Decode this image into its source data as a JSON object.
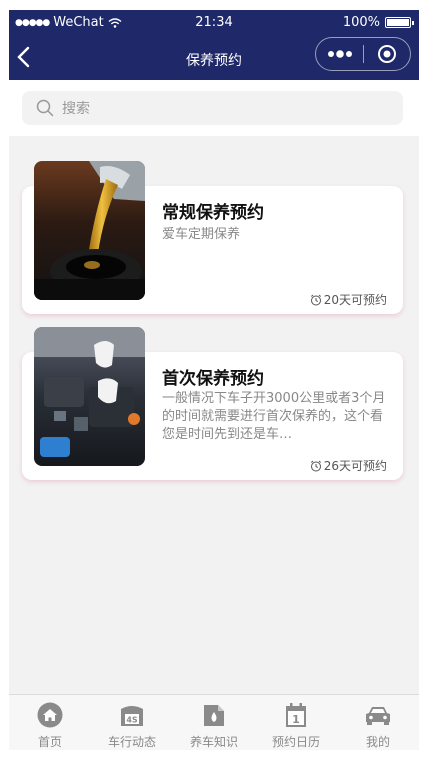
{
  "status_bar": {
    "carrier": "WeChat",
    "time": "21:34",
    "battery": "100%"
  },
  "nav": {
    "title": "保养预约"
  },
  "search": {
    "placeholder": "搜索"
  },
  "cards": [
    {
      "title": "常规保养预约",
      "subtitle": "爱车定期保养",
      "days": "20天可预约",
      "image": "oil-pouring-photo"
    },
    {
      "title": "首次保养预约",
      "subtitle": "一般情况下车子开3000公里或者3个月的时间就需要进行首次保养的，这个看您是时间先到还是车…",
      "days": "26天可预约",
      "image": "engine-repair-photo"
    }
  ],
  "tabbar": {
    "items": [
      {
        "label": "首页",
        "icon": "home-icon"
      },
      {
        "label": "车行动态",
        "icon": "4s-shop-icon"
      },
      {
        "label": "养车知识",
        "icon": "knowledge-icon"
      },
      {
        "label": "预约日历",
        "icon": "calendar-icon"
      },
      {
        "label": "我的",
        "icon": "car-icon"
      }
    ],
    "calendar_day": "1",
    "shop_badge": "4S"
  },
  "colors": {
    "nav_bg": "#1f2868",
    "page_bg": "#f2f2f2",
    "tab_icon": "#8a8a8a"
  }
}
